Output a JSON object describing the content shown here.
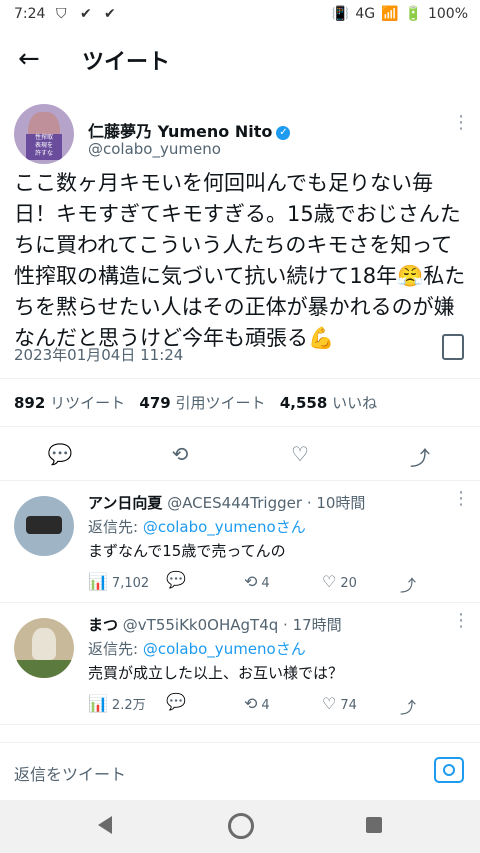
{
  "status_bar": {
    "time": "7:24",
    "network": "4G",
    "battery": "100%"
  },
  "header": {
    "title": "ツイート"
  },
  "tweet": {
    "author_name": "仁藤夢乃  Yumeno Nito",
    "handle": "@colabo_yumeno",
    "avatar_text": "性搾取\n表現を\n許すな",
    "body": "ここ数ヶ月キモいを何回叫んでも足りない毎日！キモすぎてキモすぎる。15歳でおじさんたちに買われてこういう人たちのキモさを知って性搾取の構造に気づいて抗い続けて18年😤私たちを黙らせたい人はその正体が暴かれるのが嫌なんだと思うけど今年も頑張る💪",
    "timestamp": "2023年01月04日 11:24",
    "retweets": "892",
    "retweets_label": "リツイート",
    "quotes": "479",
    "quotes_label": "引用ツイート",
    "likes": "4,558",
    "likes_label": "いいね"
  },
  "replies": [
    {
      "name": "アン日向夏",
      "handle": "@ACES444Trigger",
      "time": "· 10時間",
      "reply_to_prefix": "返信先: ",
      "reply_to_handle": "@colabo_yumeno",
      "reply_to_suffix": "さん",
      "text": "まずなんで15歳で売ってんの",
      "views": "7,102",
      "retweets": "4",
      "likes": "20"
    },
    {
      "name": "まつ",
      "handle": "@vT55iKk0OHAgT4q",
      "time": "· 17時間",
      "reply_to_prefix": "返信先: ",
      "reply_to_handle": "@colabo_yumeno",
      "reply_to_suffix": "さん",
      "text": "売買が成立した以上、お互い様では？",
      "views": "2.2万",
      "retweets": "4",
      "likes": "74"
    }
  ],
  "composer": {
    "placeholder": "返信をツイート"
  },
  "colors": {
    "accent": "#1d9bf0",
    "text": "#0f1419",
    "muted": "#536471"
  }
}
